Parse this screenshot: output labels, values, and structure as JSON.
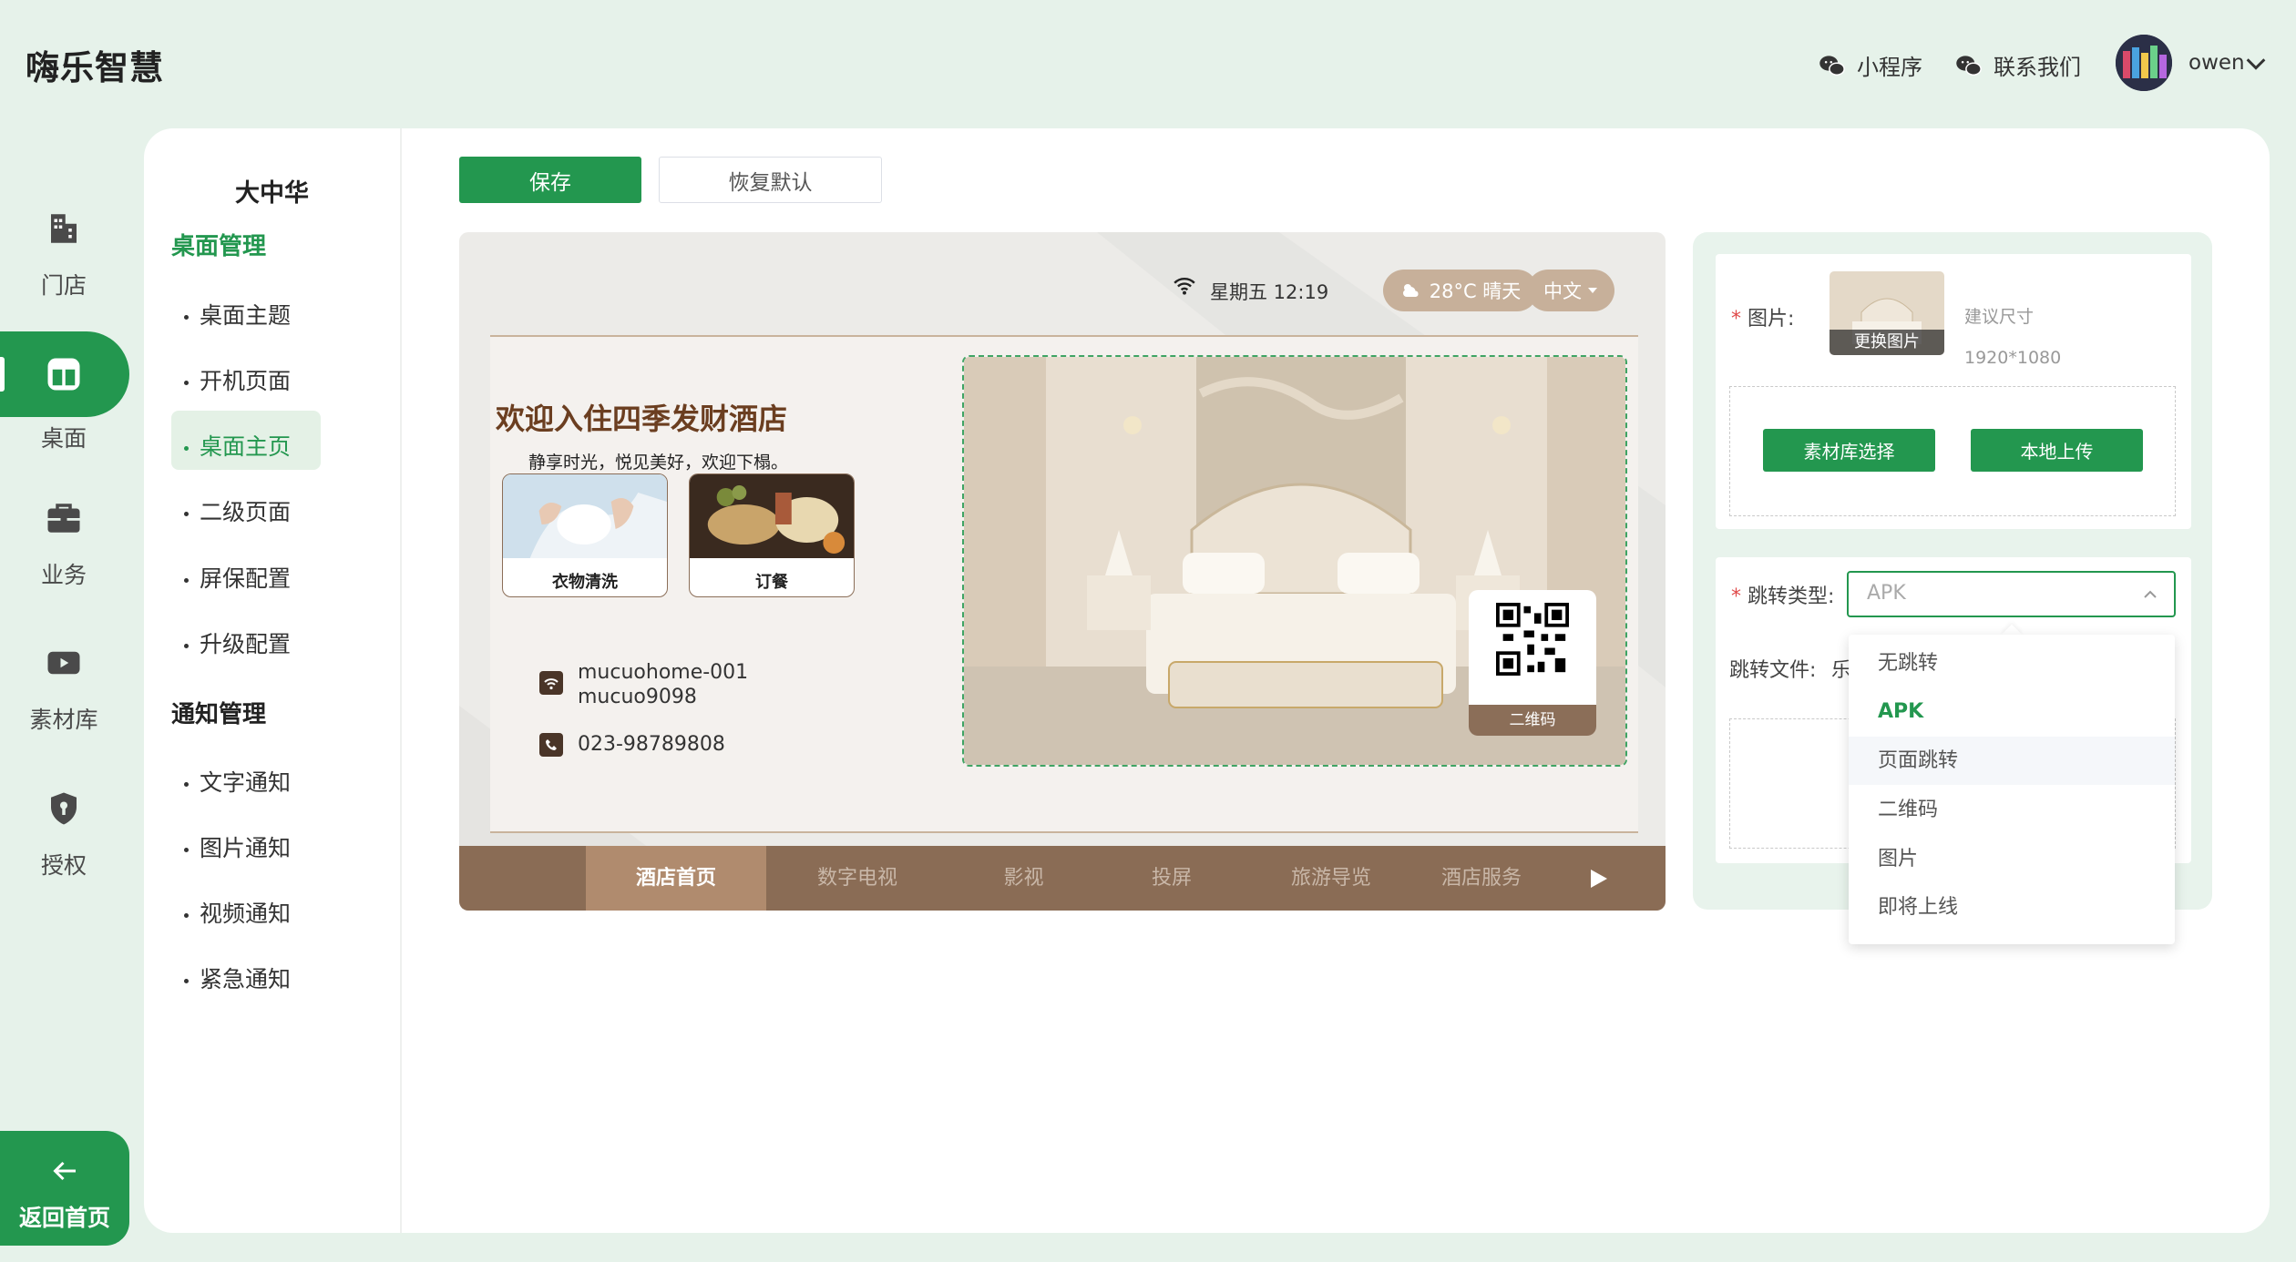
{
  "brand": "嗨乐智慧",
  "topbar": {
    "miniprogram": "小程序",
    "contact": "联系我们",
    "username": "owen"
  },
  "nav": {
    "items": [
      {
        "label": "门店",
        "icon": "store-icon"
      },
      {
        "label": "桌面",
        "icon": "desktop-icon"
      },
      {
        "label": "业务",
        "icon": "briefcase-icon"
      },
      {
        "label": "素材库",
        "icon": "media-icon"
      },
      {
        "label": "授权",
        "icon": "shield-icon"
      }
    ],
    "active": "桌面",
    "back": "返回首页"
  },
  "sub_nav": {
    "store_name": "大中华",
    "sections": [
      {
        "title": "桌面管理",
        "items": [
          "桌面主题",
          "开机页面",
          "桌面主页",
          "二级页面",
          "屏保配置",
          "升级配置"
        ]
      },
      {
        "title": "通知管理",
        "items": [
          "文字通知",
          "图片通知",
          "视频通知",
          "紧急通知"
        ]
      }
    ],
    "active_item": "桌面主页"
  },
  "toolbar": {
    "save": "保存",
    "reset": "恢复默认"
  },
  "preview": {
    "datetime": "星期五 12:19",
    "weather": "28°C 晴天",
    "language": "中文",
    "title": "欢迎入住四季发财酒店",
    "slogan": "静享时光，悦见美好，欢迎下榻。",
    "services": [
      "衣物清洗",
      "订餐"
    ],
    "wifi_name": "mucuohome-001",
    "wifi_password": "mucuo9098",
    "phone": "023-98789808",
    "qr_label": "二维码",
    "tabs": [
      "酒店首页",
      "数字电视",
      "影视",
      "投屏",
      "旅游导览",
      "酒店服务"
    ],
    "active_tab": "酒店首页"
  },
  "config": {
    "image_label": "图片:",
    "change_image": "更换图片",
    "size_hint": "建议尺寸",
    "size_value": "1920*1080",
    "library_select": "素材库选择",
    "local_upload": "本地上传",
    "jump_type_label": "跳转类型:",
    "jump_type_value": "APK",
    "jump_file_label": "跳转文件:",
    "jump_file_value": "乐",
    "options": [
      "无跳转",
      "APK",
      "页面跳转",
      "二维码",
      "图片",
      "即将上线"
    ],
    "selected_option": "APK",
    "hovered_option": "页面跳转"
  },
  "colors": {
    "primary": "#23974f",
    "background": "#e6f2ea",
    "brown": "#8a6c55"
  }
}
